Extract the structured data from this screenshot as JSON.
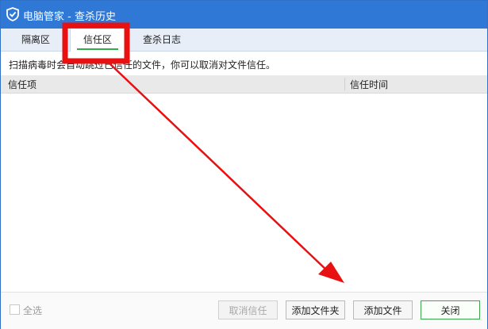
{
  "window": {
    "title": "电脑管家 - 查杀历史"
  },
  "tabs": [
    {
      "label": "隔离区"
    },
    {
      "label": "信任区"
    },
    {
      "label": "查杀日志"
    }
  ],
  "hint": "扫描病毒时会自动跳过已信任的文件，你可以取消对文件信任。",
  "table": {
    "columns": [
      "信任项",
      "信任时间"
    ],
    "rows": []
  },
  "footer": {
    "select_all_label": "全选",
    "buttons": {
      "untrust": "取消信任",
      "add_folder": "添加文件夹",
      "add_file": "添加文件",
      "close": "关闭"
    }
  },
  "annotation": {
    "highlight_color": "#e81010",
    "arrow_color": "#e81010"
  },
  "colors": {
    "titlebar": "#2f78d6",
    "active_tab_underline": "#2eae4a"
  }
}
